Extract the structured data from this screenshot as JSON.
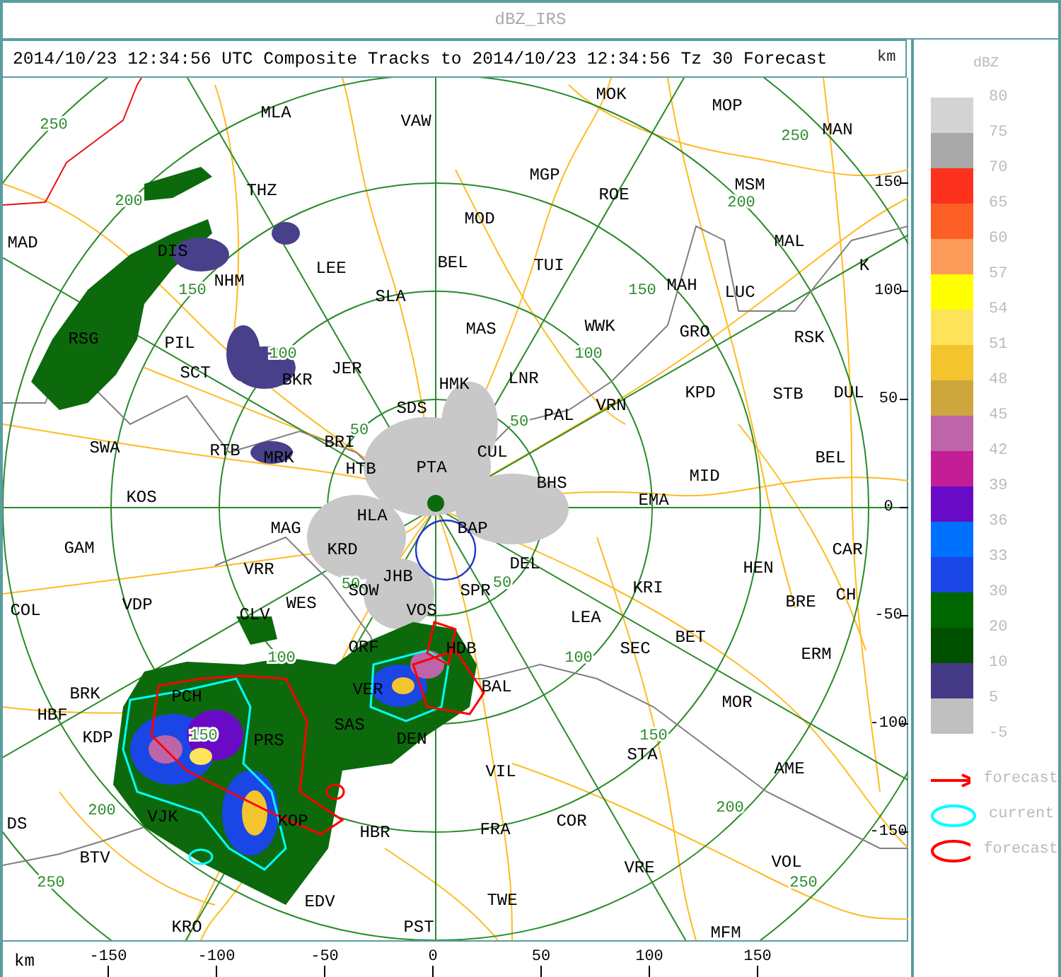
{
  "window": {
    "title": "dBZ_IRS"
  },
  "header": {
    "text": "2014/10/23 12:34:56 UTC Composite Tracks to 2014/10/23 12:34:56 Tz 30 Forecast"
  },
  "map": {
    "cities": [
      "MOK",
      "MLA",
      "VAW",
      "MOP",
      "MAN",
      "THZ",
      "MGP",
      "ROE",
      "MSM",
      "MOD",
      "MAD",
      "DIS",
      "MAL",
      "LEE",
      "BEL",
      "TUI",
      "K",
      "NHM",
      "SLA",
      "MAH",
      "LUC",
      "RSG",
      "PIL",
      "MAS",
      "WWK",
      "GRO",
      "RSK",
      "SCT",
      "BKR",
      "JER",
      "HMK",
      "LNR",
      "SDS",
      "PAL",
      "VRN",
      "KPD",
      "STB",
      "DUL",
      "SWA",
      "RTB",
      "MRK",
      "BRI",
      "CUL",
      "BEL",
      "HTB",
      "PTA",
      "BHS",
      "MID",
      "KOS",
      "EMA",
      "HLA",
      "MAG",
      "BAP",
      "GAM",
      "KRD",
      "CAR",
      "VRR",
      "JHB",
      "DEL",
      "HEN",
      "COL",
      "VDP",
      "CLV",
      "WES",
      "SOW",
      "VOS",
      "SPR",
      "LEA",
      "KRI",
      "BRE",
      "CH",
      "ORF",
      "HDB",
      "SEC",
      "BET",
      "ERM",
      "BRK",
      "PCH",
      "VER",
      "BAL",
      "MOR",
      "HBF",
      "KDP",
      "PRS",
      "SAS",
      "DEN",
      "VIL",
      "STA",
      "AME",
      "DS",
      "VJK",
      "KOP",
      "HBR",
      "FRA",
      "COR",
      "BTV",
      "VRE",
      "VOL",
      "EDV",
      "TWE",
      "KRO",
      "PST",
      "MFM"
    ],
    "range_ring_labels": [
      "250",
      "200",
      "150",
      "100",
      "50",
      "250",
      "200",
      "150",
      "100",
      "50",
      "50",
      "100",
      "150",
      "200",
      "250",
      "50",
      "100",
      "150",
      "200",
      "250"
    ],
    "x_axis": {
      "unit": "km",
      "ticks": [
        "-150",
        "-100",
        "-50",
        "0",
        "50",
        "100",
        "150"
      ]
    },
    "y_axis": {
      "unit": "km",
      "ticks": [
        "150",
        "100",
        "50",
        "0",
        "-50",
        "-100",
        "-150"
      ]
    }
  },
  "legend": {
    "title": "dBZ",
    "scale": [
      {
        "label": "80",
        "color": "#d3d3d3"
      },
      {
        "label": "75",
        "color": "#a9a9a9"
      },
      {
        "label": "70",
        "color": "#fc321e"
      },
      {
        "label": "65",
        "color": "#fc5f25"
      },
      {
        "label": "60",
        "color": "#fc9a5a"
      },
      {
        "label": "57",
        "color": "#ffff00"
      },
      {
        "label": "54",
        "color": "#fce35a"
      },
      {
        "label": "51",
        "color": "#f3c42e"
      },
      {
        "label": "48",
        "color": "#cea73c"
      },
      {
        "label": "45",
        "color": "#bd65a8"
      },
      {
        "label": "42",
        "color": "#c41e96"
      },
      {
        "label": "39",
        "color": "#690bc6"
      },
      {
        "label": "36",
        "color": "#0070ff"
      },
      {
        "label": "33",
        "color": "#1b46e6"
      },
      {
        "label": "30",
        "color": "#006600"
      },
      {
        "label": "20",
        "color": "#005000"
      },
      {
        "label": "10",
        "color": "#443a86"
      },
      {
        "label": "5",
        "color": "#c0c0c0"
      }
    ],
    "bottom_label": "-5",
    "symbols": [
      {
        "kind": "arrow",
        "color": "#ff0000",
        "label": "forecast"
      },
      {
        "kind": "ellipse",
        "color": "#00ffff",
        "label": "current"
      },
      {
        "kind": "ellipse",
        "color": "#ff0000",
        "label": "forecast"
      }
    ]
  }
}
